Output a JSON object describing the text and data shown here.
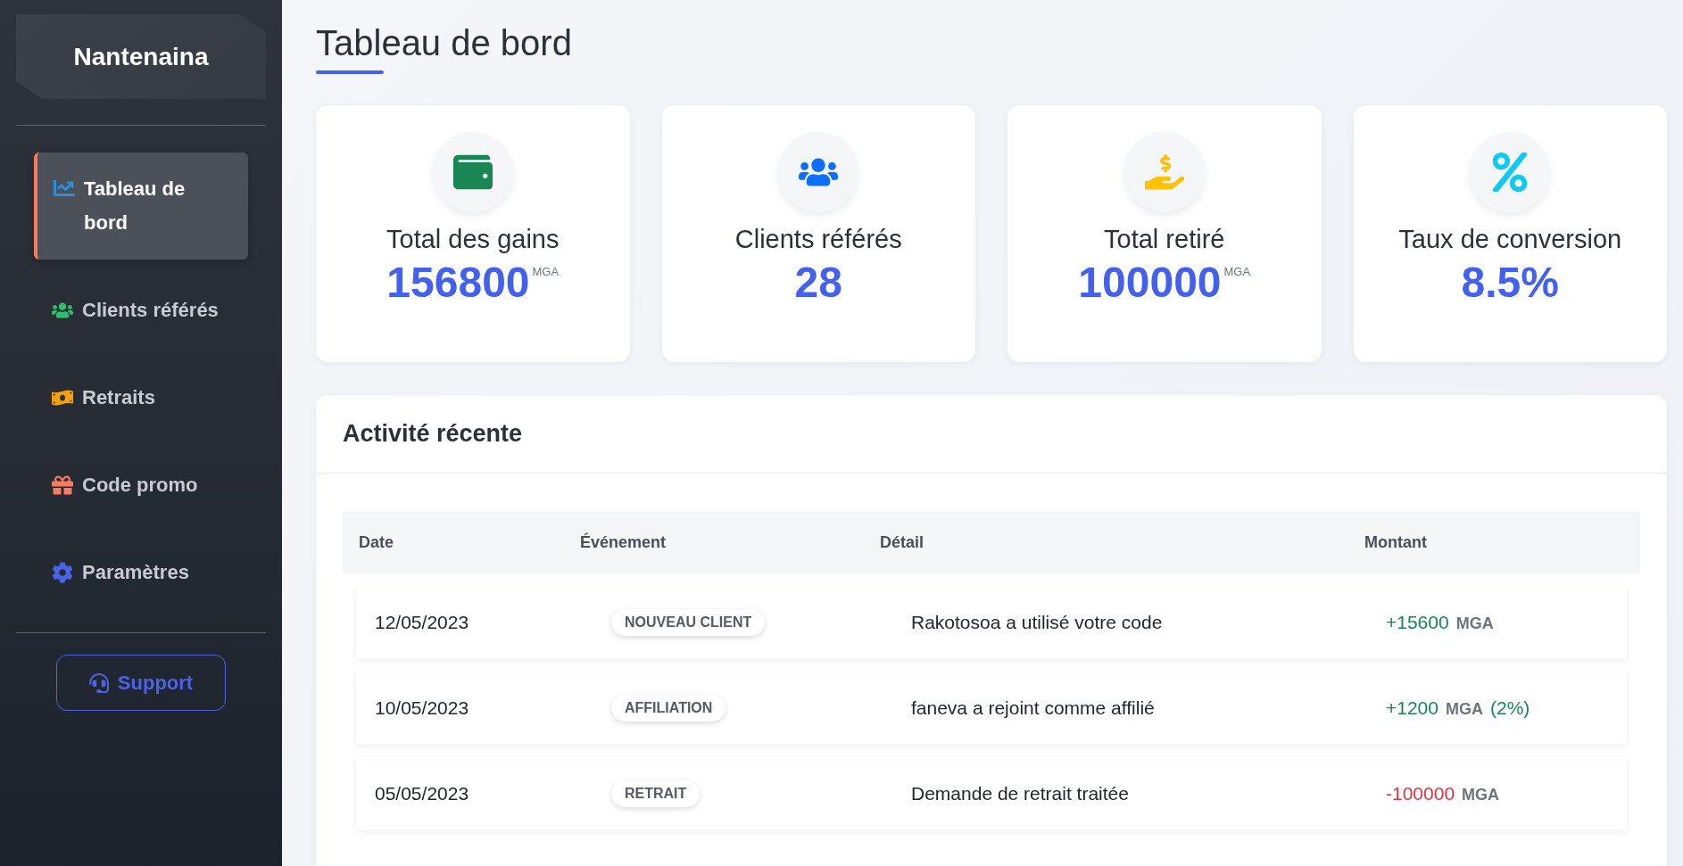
{
  "sidebar": {
    "brand": "Nantenaina",
    "items": [
      {
        "label": "Tableau de bord",
        "kind": "chart",
        "color": "#2d8fdc",
        "selected": true
      },
      {
        "label": "Clients référés",
        "kind": "users",
        "color": "#2fbf71",
        "selected": false
      },
      {
        "label": "Retraits",
        "kind": "money",
        "color": "#f5a10b",
        "selected": false
      },
      {
        "label": "Code promo",
        "kind": "gift",
        "color": "#fa7b62",
        "selected": false
      },
      {
        "label": "Paramètres",
        "kind": "gear",
        "color": "#4a63e7",
        "selected": false
      }
    ],
    "support_button": "Support"
  },
  "page_title": "Tableau de bord",
  "stats": [
    {
      "label": "Total des gains",
      "value": "156800",
      "unit": "MGA",
      "kind": "wallet",
      "color": "#198754"
    },
    {
      "label": "Clients référés",
      "value": "28",
      "kind": "users",
      "color": "#0d6efd"
    },
    {
      "label": "Total retiré",
      "value": "100000",
      "unit": "MGA",
      "kind": "hand",
      "color": "#ffc107"
    },
    {
      "label": "Taux de conversion",
      "value": "8.5%",
      "kind": "percent",
      "color": "#0dcaf0"
    }
  ],
  "activity": {
    "title": "Activité récente",
    "columns": [
      "Date",
      "Événement",
      "Détail",
      "Montant"
    ],
    "rows": [
      {
        "date": "12/05/2023",
        "event": "NOUVEAU CLIENT",
        "detail": "Rakotosoa a utilisé votre code",
        "amount": "+15600",
        "unit": "MGA",
        "kind": "credit"
      },
      {
        "date": "10/05/2023",
        "event": "AFFILIATION",
        "detail": "faneva a rejoint comme affilié",
        "amount": "+1200",
        "unit": "MGA",
        "note": "(2%)",
        "kind": "credit"
      },
      {
        "date": "05/05/2023",
        "event": "RETRAIT",
        "detail": "Demande de retrait traitée",
        "amount": "-100000",
        "unit": "MGA",
        "kind": "debit"
      }
    ]
  }
}
